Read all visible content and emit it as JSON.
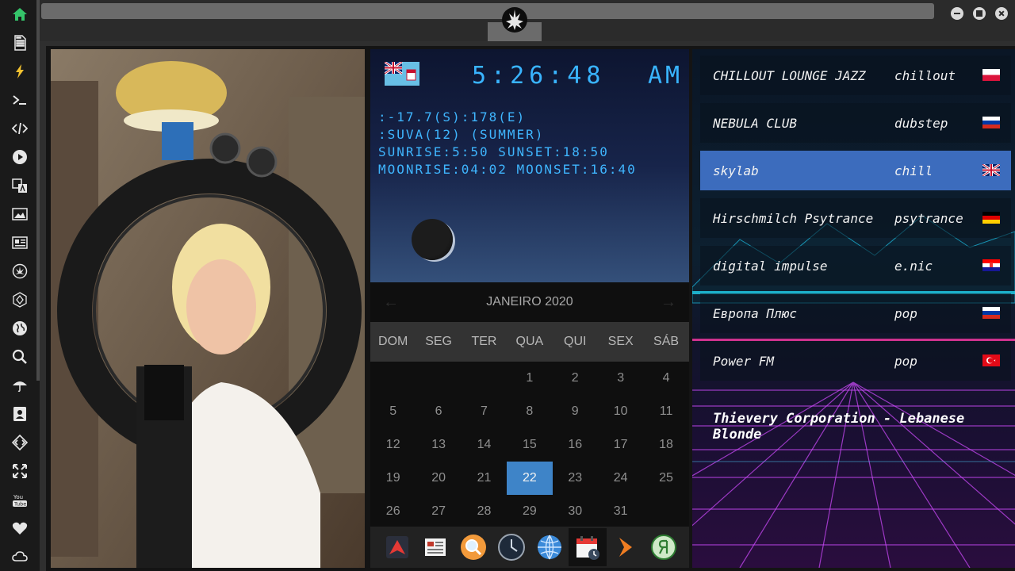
{
  "sidebar": {
    "items": [
      {
        "icon": "home-icon",
        "color": "#35c46a"
      },
      {
        "icon": "document-icon"
      },
      {
        "icon": "lightning-icon"
      },
      {
        "icon": "terminal-icon"
      },
      {
        "icon": "code-icon"
      },
      {
        "icon": "play-icon"
      },
      {
        "icon": "translate-icon"
      },
      {
        "icon": "image-icon"
      },
      {
        "icon": "newspaper-icon"
      },
      {
        "icon": "rebel-icon"
      },
      {
        "icon": "hexagon-icon"
      },
      {
        "icon": "globe-icon"
      },
      {
        "icon": "search-icon"
      },
      {
        "icon": "umbrella-icon"
      },
      {
        "icon": "contact-icon"
      },
      {
        "icon": "diamond-code-icon"
      },
      {
        "icon": "expand-icon"
      },
      {
        "icon": "youtube-icon",
        "label": "You Tube"
      },
      {
        "icon": "heart-icon"
      },
      {
        "icon": "cloud-icon"
      }
    ]
  },
  "clock": {
    "time": "5:26:48",
    "ampm": "AM",
    "lines": [
      ":-17.7(S):178(E)",
      ":SUVA(12) (SUMMER)",
      "SUNRISE:5:50 SUNSET:18:50",
      "MOONRISE:04:02 MOONSET:16:40"
    ]
  },
  "calendar": {
    "month_label": "JANEIRO 2020",
    "weekdays": [
      "DOM",
      "SEG",
      "TER",
      "QUA",
      "QUI",
      "SEX",
      "SÁB"
    ],
    "weeks": [
      [
        "",
        "",
        "",
        "1",
        "2",
        "3",
        "4"
      ],
      [
        "5",
        "6",
        "7",
        "8",
        "9",
        "10",
        "11"
      ],
      [
        "12",
        "13",
        "14",
        "15",
        "16",
        "17",
        "18"
      ],
      [
        "19",
        "20",
        "21",
        "22",
        "23",
        "24",
        "25"
      ],
      [
        "26",
        "27",
        "28",
        "29",
        "30",
        "31",
        ""
      ]
    ],
    "today": "22",
    "accent": "#3e84c8"
  },
  "dock": {
    "items": [
      "arrow-app-icon",
      "news-app-icon",
      "magnifier-app-icon",
      "clock-app-icon",
      "globe-app-icon",
      "calendar-app-icon",
      "forward-app-icon",
      "yandex-app-icon"
    ]
  },
  "radio": {
    "stations": [
      {
        "name": "CHILLOUT LOUNGE JAZZ",
        "genre": "chillout",
        "flag": "pl"
      },
      {
        "name": "NEBULA CLUB",
        "genre": "dubstep",
        "flag": "ru"
      },
      {
        "name": "skylab",
        "genre": "chill",
        "flag": "gb"
      },
      {
        "name": "Hirschmilch Psytrance",
        "genre": "psytrance",
        "flag": "de"
      },
      {
        "name": "digital impulse",
        "genre": "e.nic",
        "flag": "hr"
      },
      {
        "name": "Европа Плюс",
        "genre": "pop",
        "flag": "ru"
      },
      {
        "name": "Power FM",
        "genre": "pop",
        "flag": "tr"
      }
    ],
    "now_playing": "Thievery Corporation - Lebanese Blonde"
  }
}
